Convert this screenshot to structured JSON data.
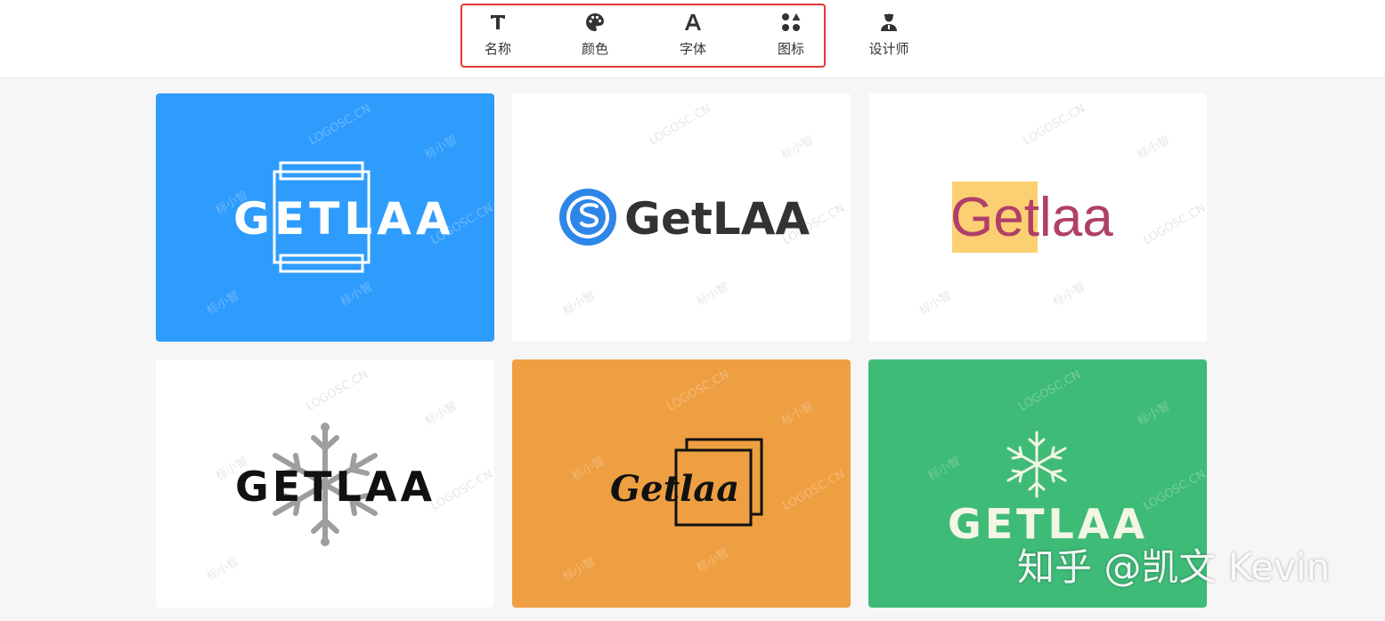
{
  "toolbar": {
    "items": [
      {
        "label": "名称",
        "icon": "text-t-icon"
      },
      {
        "label": "颜色",
        "icon": "palette-icon"
      },
      {
        "label": "字体",
        "icon": "font-a-icon"
      },
      {
        "label": "图标",
        "icon": "shapes-icon"
      },
      {
        "label": "设计师",
        "icon": "designer-icon"
      }
    ]
  },
  "watermarks": {
    "domain": "LOGOSC.CN",
    "brand": "标小智"
  },
  "logos": [
    {
      "text": "GETLAA",
      "background": "#2e9cfd",
      "text_color": "#ffffff"
    },
    {
      "text": "GetLAA",
      "background": "#ffffff",
      "text_color": "#333333",
      "icon_color": "#2e86e8"
    },
    {
      "text": "Getlaa",
      "background": "#ffffff",
      "text_color": "#b03f6a",
      "accent": "#fcd072"
    },
    {
      "text": "GETLAA",
      "background": "#ffffff",
      "text_color": "#111111",
      "icon_color": "#9e9e9e"
    },
    {
      "text": "Getlaa",
      "background": "#ee9f42",
      "text_color": "#111111"
    },
    {
      "text": "GETLAA",
      "background": "#3fbb78",
      "text_color": "#f3f6e4"
    }
  ],
  "overlay_text": "知乎 @凯文 Kevin"
}
